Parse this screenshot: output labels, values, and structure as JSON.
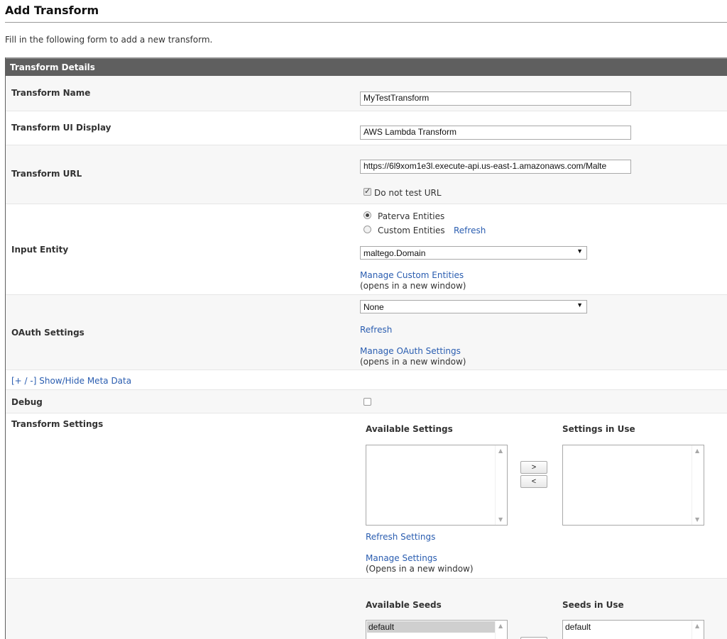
{
  "page": {
    "title": "Add Transform",
    "intro": "Fill in the following form to add a new transform."
  },
  "panel": {
    "header": "Transform Details"
  },
  "fields": {
    "transform_name": {
      "label": "Transform Name",
      "value": "MyTestTransform"
    },
    "ui_display": {
      "label": "Transform UI Display",
      "value": "AWS Lambda Transform"
    },
    "url": {
      "label": "Transform URL",
      "value": "https://6l9xom1e3l.execute-api.us-east-1.amazonaws.com/Malte",
      "no_test_label": "Do not test URL",
      "no_test_checked": true
    },
    "input_entity": {
      "label": "Input Entity",
      "radio_paterva": "Paterva Entities",
      "radio_custom": "Custom Entities",
      "refresh": "Refresh",
      "selected": "maltego.Domain",
      "manage_link": "Manage Custom Entities",
      "manage_note": "(opens in a new window)"
    },
    "oauth": {
      "label": "OAuth Settings",
      "selected": "None",
      "refresh": "Refresh",
      "manage_link": "Manage OAuth Settings",
      "manage_note": "(opens in a new window)"
    },
    "meta_toggle": "[+ / -] Show/Hide Meta Data",
    "debug": {
      "label": "Debug",
      "checked": false
    },
    "settings": {
      "label": "Transform Settings",
      "available_heading": "Available Settings",
      "in_use_heading": "Settings in Use",
      "add_btn": ">",
      "remove_btn": "<",
      "refresh_link": "Refresh Settings",
      "manage_link": "Manage Settings",
      "manage_note": "(Opens in a new window)"
    },
    "seeds": {
      "available_heading": "Available Seeds",
      "in_use_heading": "Seeds in Use",
      "available_items": [
        "default"
      ],
      "in_use_items": [
        "default"
      ]
    }
  },
  "icons": {
    "dropdown": "chevron-down-icon",
    "scroll_up": "scroll-up-icon",
    "scroll_down": "scroll-down-icon"
  }
}
